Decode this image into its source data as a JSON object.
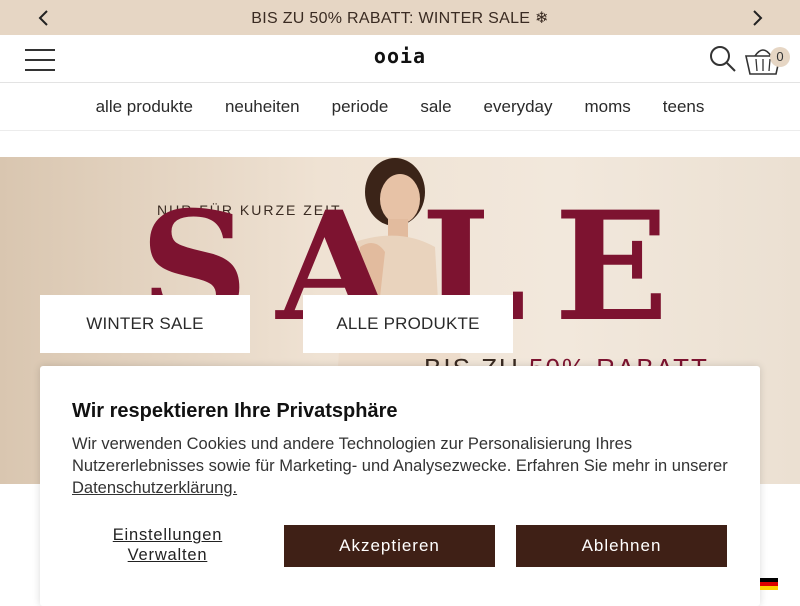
{
  "promo": {
    "text": "BIS ZU 50% RABATT: WINTER SALE ❄",
    "prev_icon": "chevron-left-icon",
    "next_icon": "chevron-right-icon"
  },
  "header": {
    "logo": "ooia",
    "menu_icon": "hamburger-menu-icon",
    "search_icon": "search-icon",
    "cart_icon": "basket-icon",
    "cart_count": "0"
  },
  "nav": {
    "items": [
      "alle produkte",
      "neuheiten",
      "periode",
      "sale",
      "everyday",
      "moms",
      "teens"
    ]
  },
  "hero": {
    "kicker": "NUR FÜR KURZE ZEIT",
    "headline": "SALE",
    "sub_prefix": "BIS ZU",
    "sub_value": "50% RABATT",
    "buttons": [
      "WINTER SALE",
      "ALLE PRODUKTE"
    ]
  },
  "consent": {
    "title": "Wir respektieren Ihre Privatsphäre",
    "body": "Wir verwenden Cookies und andere Technologien zur Personalisierung Ihres Nutzererlebnisses sowie für Marketing- und Analysezwecke. Erfahren Sie mehr in unserer",
    "link": "Datenschutzerklärung.",
    "settings": "Einstellungen Verwalten",
    "accept": "Akzeptieren",
    "reject": "Ablehnen"
  },
  "colors": {
    "promo_bg": "#e6d6c4",
    "accent": "#7d1330",
    "button_dark": "#3f2016"
  },
  "language_flag": "german-flag-icon"
}
